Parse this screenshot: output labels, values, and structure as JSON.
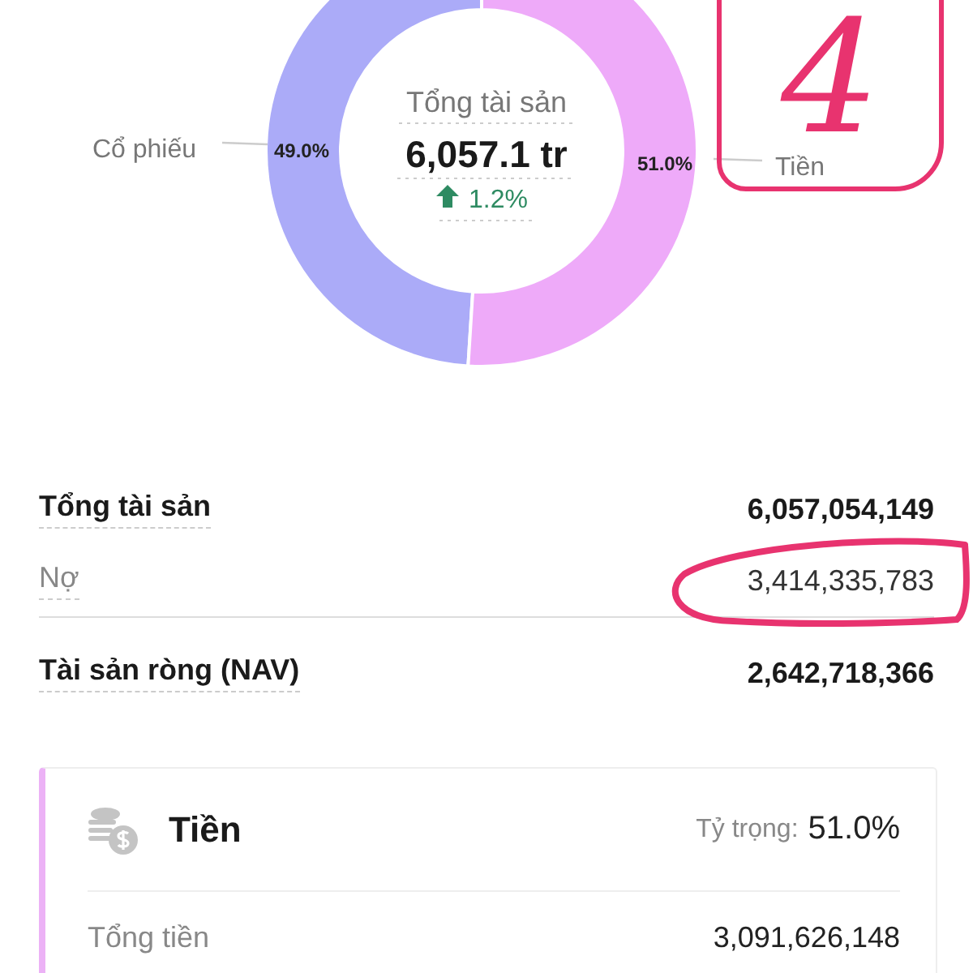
{
  "chart": {
    "chart_data": {
      "type": "donut",
      "categories": [
        "Cổ phiếu",
        "Tiền"
      ],
      "series": [
        {
          "values": [
            49.0,
            51.0
          ]
        }
      ],
      "value_labels": [
        "49.0%",
        "51.0%"
      ]
    },
    "center": {
      "label": "Tổng tài sản",
      "value": "6,057.1 tr",
      "change": "1.2%",
      "rising": true
    }
  },
  "summary": [
    {
      "label": "Tổng tài sản",
      "value": "6,057,054,149",
      "kind": "total"
    },
    {
      "label": "Nợ",
      "value": "3,414,335,783",
      "kind": "debt",
      "circled": true
    },
    {
      "label": "Tài sản ròng (NAV)",
      "value": "2,642,718,366",
      "kind": "net"
    }
  ],
  "card": {
    "title": "Tiền",
    "weight_label": "Tỷ trọng:",
    "weight": "51.0%",
    "rows": [
      {
        "label": "Tổng tiền",
        "value": "3,091,626,148"
      }
    ]
  },
  "annotations": {
    "number": "4"
  }
}
